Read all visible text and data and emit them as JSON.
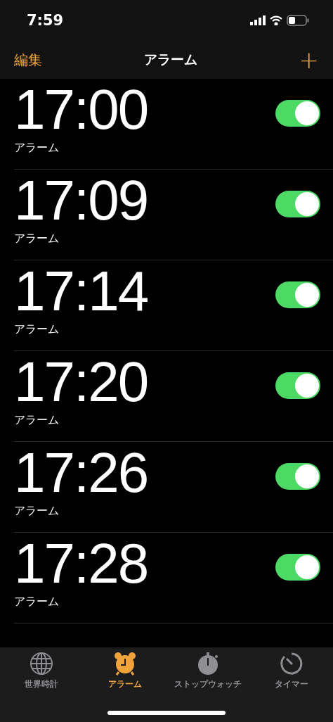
{
  "status_bar": {
    "time": "7:59"
  },
  "nav": {
    "edit": "編集",
    "title": "アラーム",
    "add": "+"
  },
  "alarms": [
    {
      "time": "17:00",
      "label": "アラーム",
      "on": true
    },
    {
      "time": "17:09",
      "label": "アラーム",
      "on": true
    },
    {
      "time": "17:14",
      "label": "アラーム",
      "on": true
    },
    {
      "time": "17:20",
      "label": "アラーム",
      "on": true
    },
    {
      "time": "17:26",
      "label": "アラーム",
      "on": true
    },
    {
      "time": "17:28",
      "label": "アラーム",
      "on": true
    }
  ],
  "tabs": [
    {
      "kind": "globe",
      "label": "世界時計",
      "selected": false
    },
    {
      "kind": "alarm",
      "label": "アラーム",
      "selected": true
    },
    {
      "kind": "stopwatch",
      "label": "ストップウォッチ",
      "selected": false
    },
    {
      "kind": "timer",
      "label": "タイマー",
      "selected": false
    }
  ]
}
